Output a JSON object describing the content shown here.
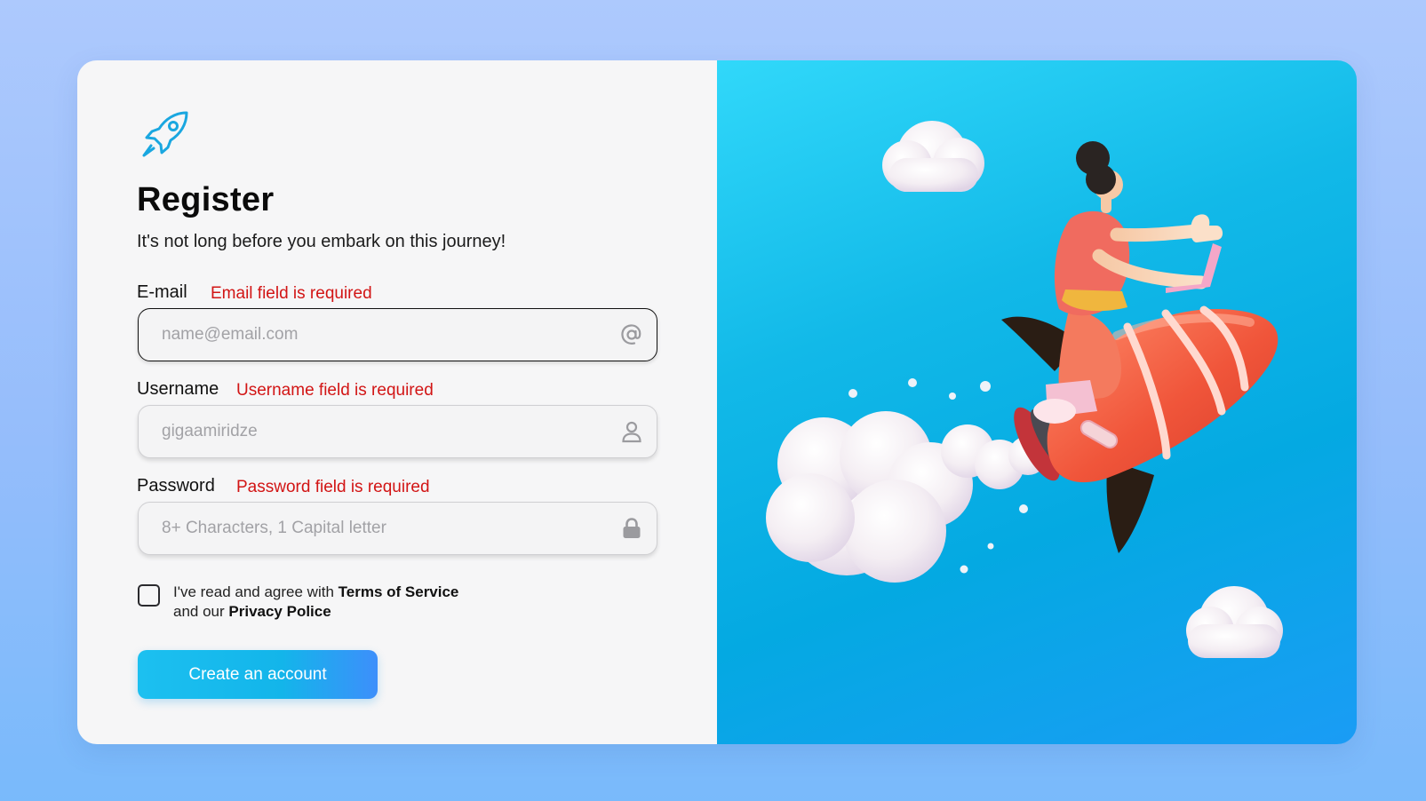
{
  "form": {
    "title": "Register",
    "subtitle": "It's not long before you embark on this journey!",
    "email": {
      "label": "E-mail",
      "error": "Email field is required",
      "placeholder": "name@email.com",
      "value": "",
      "icon": "at-sign-icon"
    },
    "username": {
      "label": "Username",
      "error": "Username field is required",
      "placeholder": "gigaamiridze",
      "value": "",
      "icon": "user-icon"
    },
    "password": {
      "label": "Password",
      "error": "Password field is required",
      "placeholder": "8+ Characters, 1 Capital letter",
      "value": "",
      "icon": "lock-icon"
    },
    "terms": {
      "checked": false,
      "prefix": "I've read and agree with ",
      "terms_link": "Terms of Service",
      "middle": "and our ",
      "privacy_link": "Privacy Police"
    },
    "submit_label": "Create an account"
  },
  "logo_icon": "rocket-icon",
  "illustration": "person-riding-rocket-illustration",
  "colors": {
    "accent": "#13b5ea",
    "error": "#d21515",
    "panel_bg": "#f6f6f7",
    "art_bg": "#04a9e2"
  }
}
